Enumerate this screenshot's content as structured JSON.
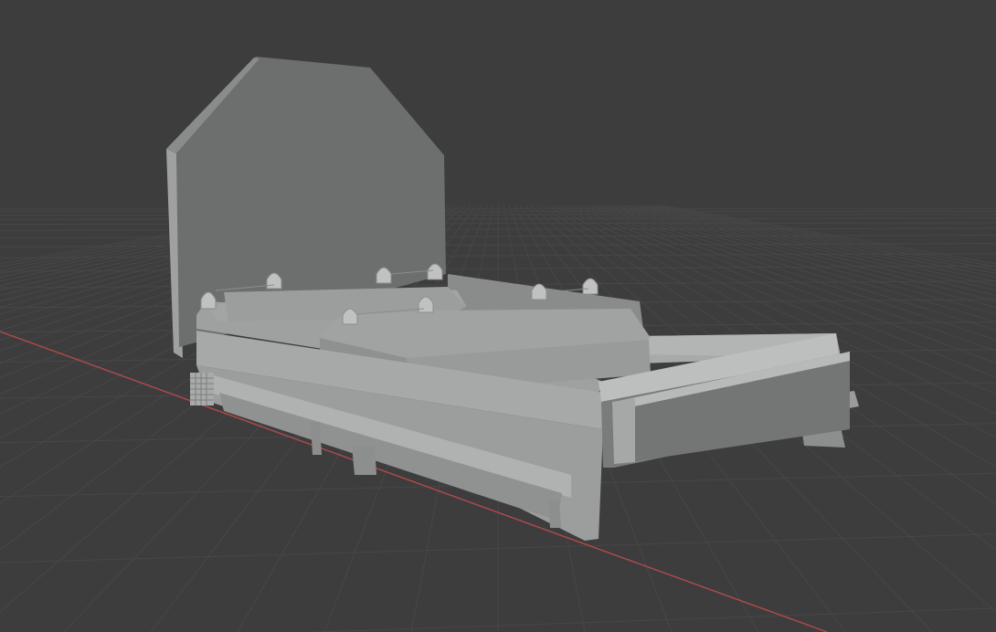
{
  "viewport": {
    "background_color": "#3d3d3d",
    "grid_color": "#474747",
    "x_axis_color": "#b34a4a",
    "object": {
      "description_icon": "3d-mesh-icon",
      "base_color": "#9a9c9c",
      "light_color": "#a6a8a8",
      "dark_color": "#6e7070"
    }
  }
}
